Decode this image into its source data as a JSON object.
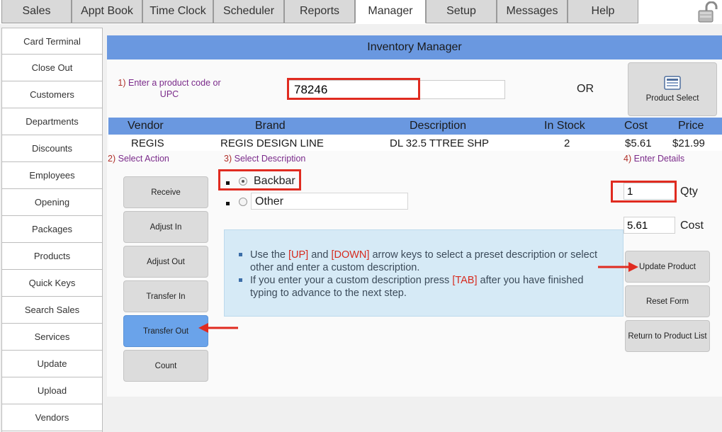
{
  "tabs": [
    {
      "label": "Sales"
    },
    {
      "label": "Appt Book"
    },
    {
      "label": "Time Clock"
    },
    {
      "label": "Scheduler"
    },
    {
      "label": "Reports"
    },
    {
      "label": "Manager"
    },
    {
      "label": "Setup"
    },
    {
      "label": "Messages"
    },
    {
      "label": "Help"
    }
  ],
  "active_tab": "Manager",
  "sidebar": {
    "items": [
      {
        "label": "Card Terminal"
      },
      {
        "label": "Close Out"
      },
      {
        "label": "Customers"
      },
      {
        "label": "Departments"
      },
      {
        "label": "Discounts"
      },
      {
        "label": "Employees"
      },
      {
        "label": "Opening"
      },
      {
        "label": "Packages"
      },
      {
        "label": "Products"
      },
      {
        "label": "Quick Keys"
      },
      {
        "label": "Search Sales"
      },
      {
        "label": "Services"
      },
      {
        "label": "Update"
      },
      {
        "label": "Upload"
      },
      {
        "label": "Vendors"
      }
    ]
  },
  "main": {
    "title": "Inventory Manager",
    "step1": {
      "num": "1)",
      "text": "Enter a product code or UPC"
    },
    "code_value": "78246",
    "or_label": "OR",
    "product_select_label": "Product Select",
    "table": {
      "headers": [
        "Vendor",
        "Brand",
        "Description",
        "In Stock",
        "Cost",
        "Price"
      ],
      "row": [
        "REGIS",
        "REGIS DESIGN LINE",
        "DL 32.5 TTREE SHP",
        "2",
        "$5.61",
        "$21.99"
      ]
    },
    "step2": {
      "num": "2)",
      "text": "Select Action"
    },
    "step3": {
      "num": "3)",
      "text": "Select Description"
    },
    "step4": {
      "num": "4)",
      "text": "Enter Details"
    },
    "actions": [
      {
        "label": "Receive"
      },
      {
        "label": "Adjust In"
      },
      {
        "label": "Adjust Out"
      },
      {
        "label": "Transfer In"
      },
      {
        "label": "Transfer Out"
      },
      {
        "label": "Count"
      }
    ],
    "selected_action": "Transfer Out",
    "descriptions": {
      "backbar_label": "Backbar",
      "other_label": "Other",
      "other_value": "",
      "selected": "Backbar"
    },
    "details": {
      "qty_value": "1",
      "qty_label": "Qty",
      "cost_value": "5.61",
      "cost_label": "Cost"
    },
    "buttons": {
      "update_product": "Update Product",
      "reset_form": "Reset Form",
      "return_to_list": "Return to Product List"
    },
    "info": {
      "line1": {
        "t1": "Use the ",
        "k1": "[UP]",
        "t2": " and ",
        "k2": "[DOWN]",
        "t3": " arrow keys to select a preset description or select other and enter a custom description."
      },
      "line2": {
        "t1": "If you enter your a custom description press ",
        "k1": "[TAB]",
        "t2": " after you have finished typing to advance to the next step."
      }
    }
  },
  "colors": {
    "header_blue": "#6a98e0",
    "highlight_red": "#e02b20",
    "active_button": "#6aa3ea",
    "info_bg": "#d6eaf6"
  }
}
